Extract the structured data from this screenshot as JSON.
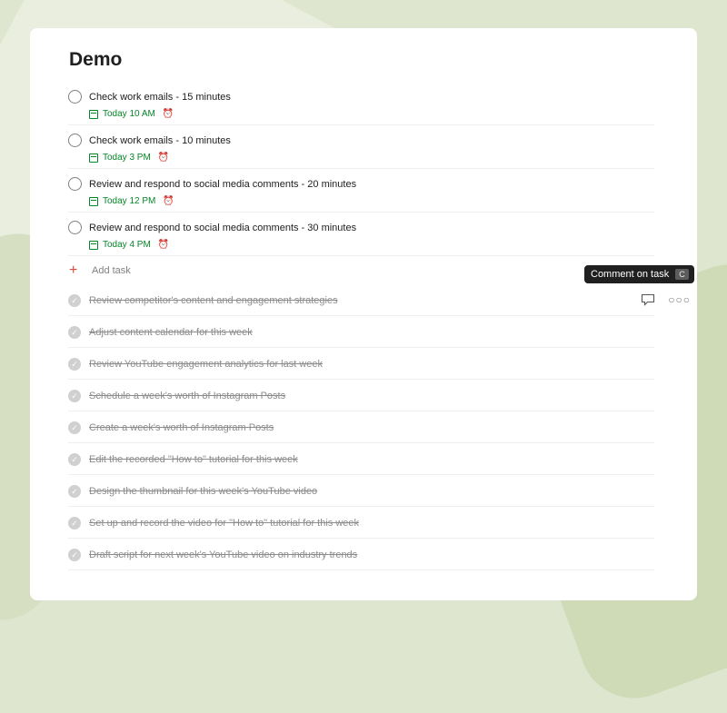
{
  "project": {
    "title": "Demo"
  },
  "tasks": [
    {
      "text": "Check work emails - 15 minutes",
      "due": "Today 10 AM",
      "reminder_icon": "alarm-icon"
    },
    {
      "text": "Check work emails - 10 minutes",
      "due": "Today 3 PM",
      "reminder_icon": "alarm-icon"
    },
    {
      "text": "Review and respond to social media comments - 20 minutes",
      "due": "Today 12 PM",
      "reminder_icon": "alarm-icon"
    },
    {
      "text": "Review and respond to social media comments - 30 minutes",
      "due": "Today 4 PM",
      "reminder_icon": "alarm-icon"
    }
  ],
  "add_task": {
    "label": "Add task"
  },
  "completed": [
    {
      "text": "Review competitor's content and engagement strategies"
    },
    {
      "text": "Adjust content calendar for this week"
    },
    {
      "text": "Review YouTube engagement analytics for last week"
    },
    {
      "text": "Schedule a week's worth of Instagram Posts"
    },
    {
      "text": "Create a week's worth of Instagram Posts"
    },
    {
      "text": "Edit the recorded \"How to\" tutorial for this week"
    },
    {
      "text": "Design the thumbnail for this week's YouTube video"
    },
    {
      "text": "Set up and record the video for \"How to\" tutorial for this week"
    },
    {
      "text": "Draft script for next week's YouTube video on industry trends"
    }
  ],
  "tooltip": {
    "label": "Comment on task",
    "shortcut": "C"
  },
  "colors": {
    "accent_red": "#dc4c3e",
    "due_green": "#058527"
  }
}
